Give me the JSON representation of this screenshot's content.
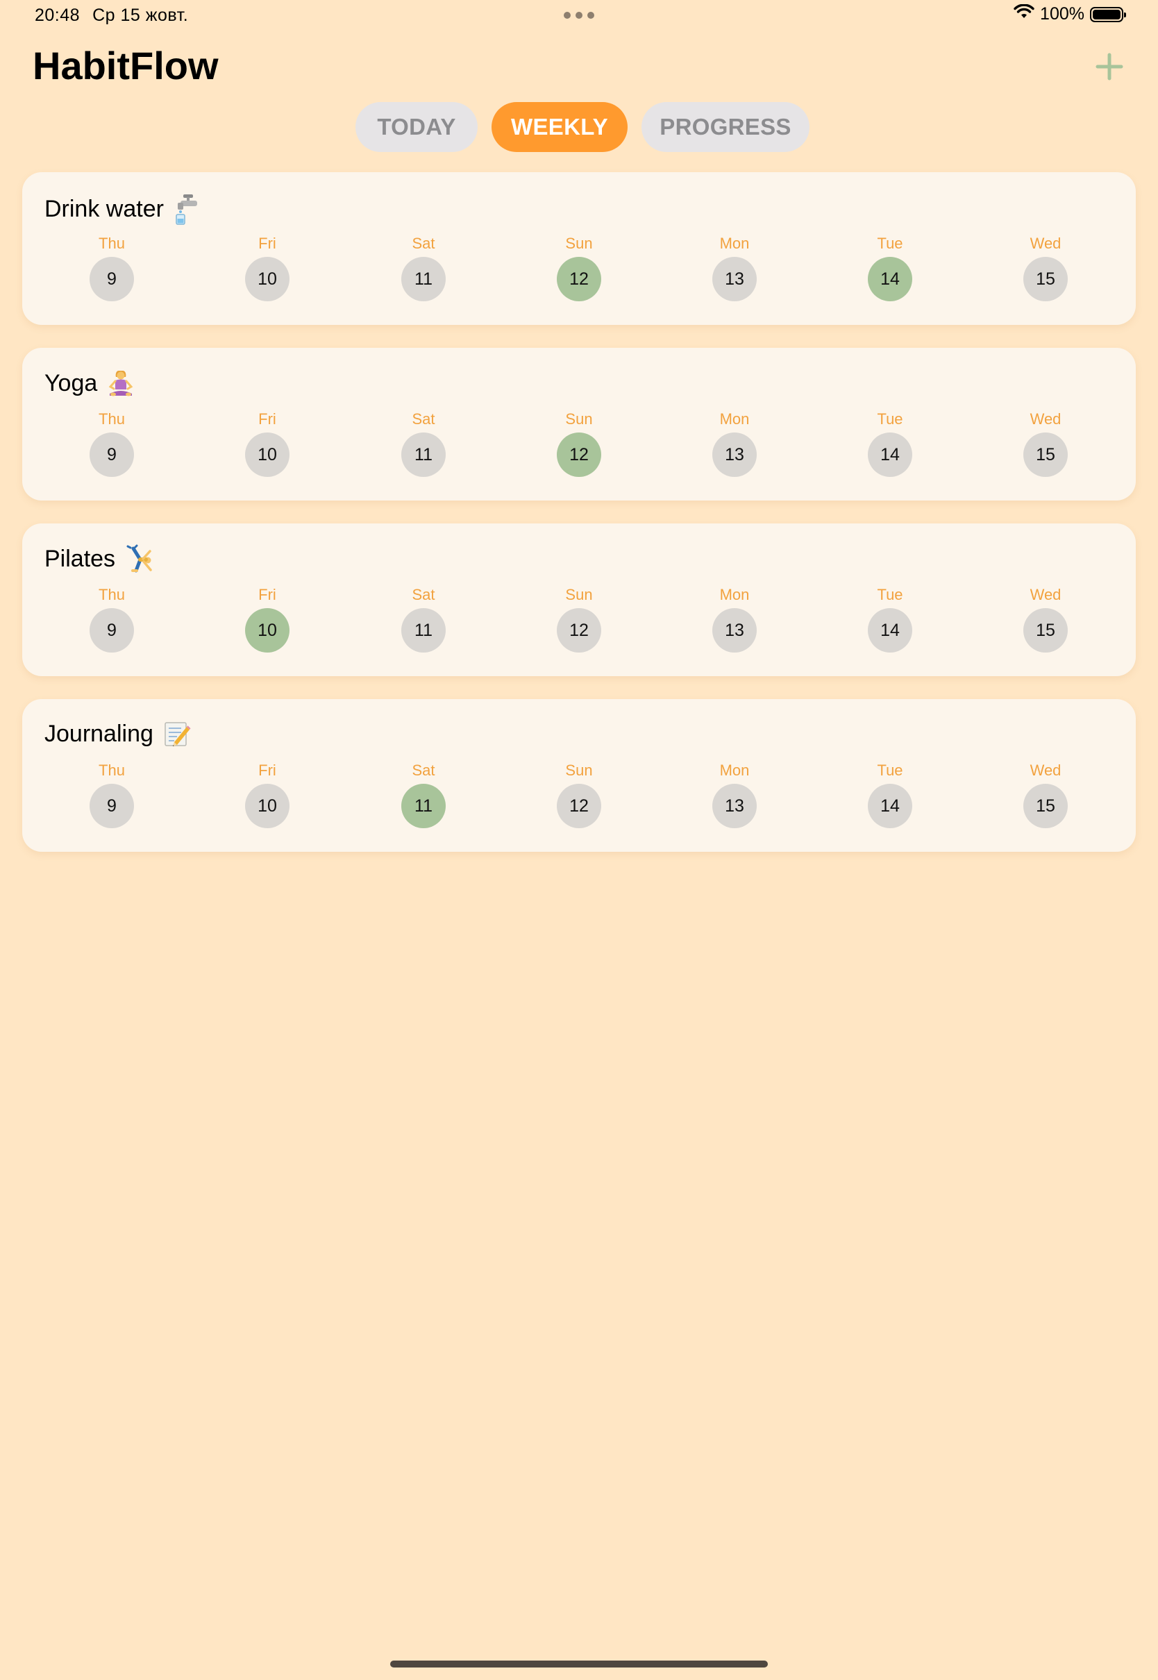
{
  "status_bar": {
    "time": "20:48",
    "date": "Ср 15 жовт.",
    "battery": "100%"
  },
  "header": {
    "title": "HabitFlow",
    "add_icon": "plus-icon",
    "accent_color": "#A8C49A"
  },
  "tabs": [
    {
      "label": "TODAY",
      "active": false
    },
    {
      "label": "WEEKLY",
      "active": true
    },
    {
      "label": "PROGRESS",
      "active": false
    }
  ],
  "colors": {
    "background": "#FFE6C4",
    "card": "#FCF5EB",
    "active_tab": "#FF9A2E",
    "day_label": "#F2A23F",
    "done": "#A8C49A",
    "not_done": "#D9D6D2"
  },
  "habits": [
    {
      "name": "Drink water",
      "icon": "faucet-icon",
      "days": [
        {
          "label": "Thu",
          "date": "9",
          "done": false
        },
        {
          "label": "Fri",
          "date": "10",
          "done": false
        },
        {
          "label": "Sat",
          "date": "11",
          "done": false
        },
        {
          "label": "Sun",
          "date": "12",
          "done": true
        },
        {
          "label": "Mon",
          "date": "13",
          "done": false
        },
        {
          "label": "Tue",
          "date": "14",
          "done": true
        },
        {
          "label": "Wed",
          "date": "15",
          "done": false
        }
      ]
    },
    {
      "name": "Yoga",
      "icon": "yoga-person-icon",
      "days": [
        {
          "label": "Thu",
          "date": "9",
          "done": false
        },
        {
          "label": "Fri",
          "date": "10",
          "done": false
        },
        {
          "label": "Sat",
          "date": "11",
          "done": false
        },
        {
          "label": "Sun",
          "date": "12",
          "done": true
        },
        {
          "label": "Mon",
          "date": "13",
          "done": false
        },
        {
          "label": "Tue",
          "date": "14",
          "done": false
        },
        {
          "label": "Wed",
          "date": "15",
          "done": false
        }
      ]
    },
    {
      "name": "Pilates",
      "icon": "cartwheel-person-icon",
      "days": [
        {
          "label": "Thu",
          "date": "9",
          "done": false
        },
        {
          "label": "Fri",
          "date": "10",
          "done": true
        },
        {
          "label": "Sat",
          "date": "11",
          "done": false
        },
        {
          "label": "Sun",
          "date": "12",
          "done": false
        },
        {
          "label": "Mon",
          "date": "13",
          "done": false
        },
        {
          "label": "Tue",
          "date": "14",
          "done": false
        },
        {
          "label": "Wed",
          "date": "15",
          "done": false
        }
      ]
    },
    {
      "name": "Journaling",
      "icon": "memo-icon",
      "days": [
        {
          "label": "Thu",
          "date": "9",
          "done": false
        },
        {
          "label": "Fri",
          "date": "10",
          "done": false
        },
        {
          "label": "Sat",
          "date": "11",
          "done": true
        },
        {
          "label": "Sun",
          "date": "12",
          "done": false
        },
        {
          "label": "Mon",
          "date": "13",
          "done": false
        },
        {
          "label": "Tue",
          "date": "14",
          "done": false
        },
        {
          "label": "Wed",
          "date": "15",
          "done": false
        }
      ]
    }
  ]
}
